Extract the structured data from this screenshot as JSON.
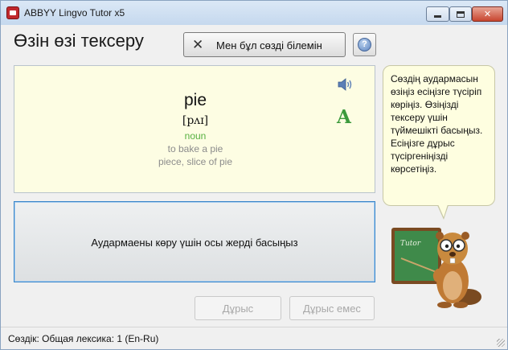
{
  "window": {
    "title": "ABBYY Lingvo Tutor x5"
  },
  "header": {
    "title": "Өзін өзі тексеру",
    "known_button_label": "Мен бұл сөзді білемін"
  },
  "card": {
    "word": "pie",
    "transcription": "[pʌɪ]",
    "part_of_speech": "noun",
    "examples": [
      "to bake a pie",
      "piece, slice of pie"
    ]
  },
  "reveal": {
    "label": "Аудармаены көру үшін осы жерді басыңыз"
  },
  "actions": {
    "correct_label": "Дұрыс",
    "wrong_label": "Дұрыс емес"
  },
  "bubble": {
    "text": "Сөздің аудармасын өзіңіз есіңізге түсіріп көріңіз. Өзіңізді тексеру үшін түймешікті басыңыз. Есіңізге дұрыс түсіргеніңізді көрсетіңіз."
  },
  "mascot": {
    "board_text": "Tutor"
  },
  "status": {
    "text": "Сөздік: Общая лексика: 1 (En-Ru)"
  },
  "colors": {
    "card_bg": "#fdfde3",
    "part_of_speech": "#56b040",
    "font_icon": "#3c9a3c",
    "reveal_border": "#3a86c9"
  }
}
